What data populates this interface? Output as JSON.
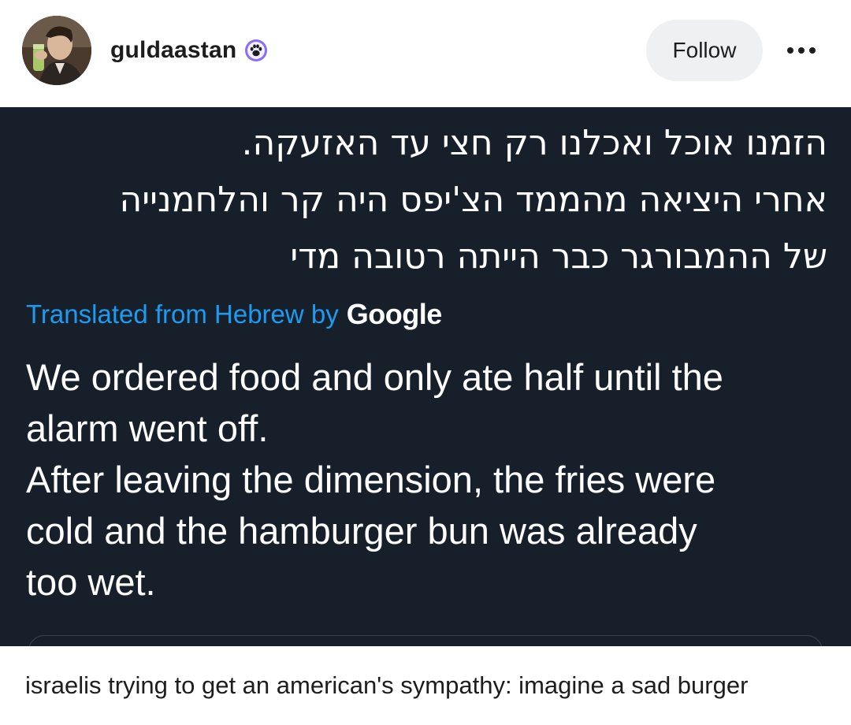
{
  "post": {
    "username": "guldaastan",
    "follow_label": "Follow"
  },
  "tweet": {
    "hebrew_text": "הזמנו אוכל ואכלנו רק חצי עד האזעקה.\nאחרי היציאה מהממד הצ'יפס היה קר והלחמנייה\nשל ההמבורגר כבר הייתה רטובה מדי",
    "translation_label": "Translated from Hebrew by",
    "translation_provider": "Google",
    "english_text": "We ordered food and only ate half until the\nalarm went off.\nAfter leaving the dimension, the fries were\ncold and the hamburger bun was already\ntoo wet."
  },
  "caption": "israelis trying to get an american's sympathy: imagine a sad burger",
  "icons": {
    "badge": "paw-badge-icon",
    "more": "more-options-icon"
  },
  "colors": {
    "tweet_background": "#17202a",
    "translation_link": "#1d9bf0",
    "follow_button_bg": "#eef0f2",
    "badge_purple": "#8b6cf6"
  }
}
